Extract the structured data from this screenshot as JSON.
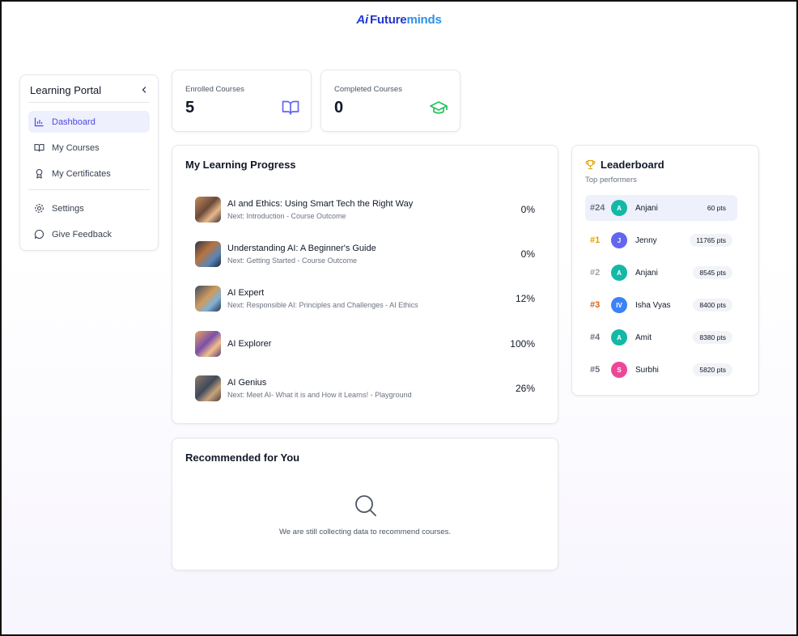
{
  "brand": {
    "logo_ai": "Ai",
    "logo_text_1": "Future",
    "logo_text_2": "minds"
  },
  "sidebar": {
    "title": "Learning Portal",
    "collapse_icon": "chevron-left-icon",
    "items": [
      {
        "label": "Dashboard",
        "icon": "bar-chart-icon",
        "active": true
      },
      {
        "label": "My Courses",
        "icon": "book-icon"
      },
      {
        "label": "My Certificates",
        "icon": "award-icon"
      },
      {
        "label": "Settings",
        "icon": "gear-icon"
      },
      {
        "label": "Give Feedback",
        "icon": "message-icon"
      }
    ]
  },
  "stats": [
    {
      "label": "Enrolled Courses",
      "value": "5",
      "icon": "book-open-icon",
      "color": "#6366f1"
    },
    {
      "label": "Completed Courses",
      "value": "0",
      "icon": "graduation-cap-icon",
      "color": "#22c55e"
    }
  ],
  "progress": {
    "title": "My Learning Progress",
    "courses": [
      {
        "name": "AI and Ethics: Using Smart Tech the Right Way",
        "next": "Next: Introduction - Course Outcome",
        "percent": "0%"
      },
      {
        "name": "Understanding AI: A Beginner's Guide",
        "next": "Next: Getting Started - Course Outcome",
        "percent": "0%"
      },
      {
        "name": "AI Expert",
        "next": "Next: Responsible AI: Principles and Challenges - AI Ethics",
        "percent": "12%"
      },
      {
        "name": "AI Explorer",
        "next": "",
        "percent": "100%"
      },
      {
        "name": "AI Genius",
        "next": "Next: Meet AI- What it is and How it Learns! - Playground",
        "percent": "26%"
      }
    ]
  },
  "recommend": {
    "title": "Recommended for You",
    "empty_text": "We are still collecting data to recommend courses."
  },
  "leaderboard": {
    "title": "Leaderboard",
    "subtitle": "Top performers",
    "rows": [
      {
        "rank": "#24",
        "initials": "A",
        "name": "Anjani",
        "points": "60 pts",
        "color": "#14b8a6",
        "me": true
      },
      {
        "rank": "#1",
        "initials": "J",
        "name": "Jenny",
        "points": "11765 pts",
        "color": "#6366f1"
      },
      {
        "rank": "#2",
        "initials": "A",
        "name": "Anjani",
        "points": "8545 pts",
        "color": "#14b8a6"
      },
      {
        "rank": "#3",
        "initials": "IV",
        "name": "Isha Vyas",
        "points": "8400 pts",
        "color": "#3b82f6"
      },
      {
        "rank": "#4",
        "initials": "A",
        "name": "Amit",
        "points": "8380 pts",
        "color": "#14b8a6"
      },
      {
        "rank": "#5",
        "initials": "S",
        "name": "Surbhi",
        "points": "5820 pts",
        "color": "#ec4899"
      }
    ]
  }
}
